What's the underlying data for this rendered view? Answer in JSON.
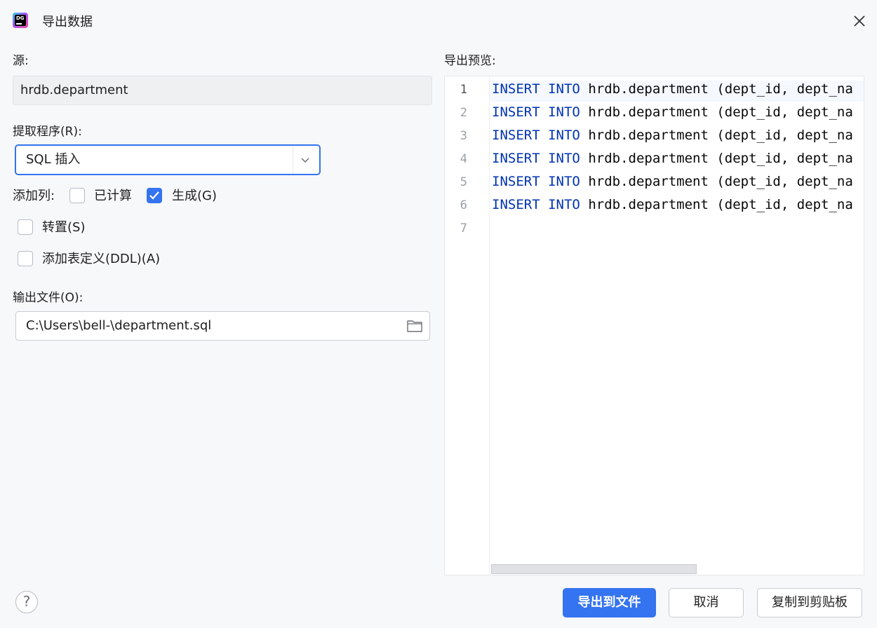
{
  "window": {
    "title": "导出数据"
  },
  "source": {
    "label": "源:",
    "value": "hrdb.department"
  },
  "extractor": {
    "label": "提取程序(R):",
    "selected": "SQL 插入"
  },
  "columns": {
    "label": "添加列:",
    "computed": {
      "label": "已计算",
      "checked": false
    },
    "generated": {
      "label": "生成(G)",
      "checked": true
    }
  },
  "options": {
    "transpose": {
      "label": "转置(S)",
      "checked": false
    },
    "ddl": {
      "label": "添加表定义(DDL)(A)",
      "checked": false
    }
  },
  "output": {
    "label": "输出文件(O):",
    "path": "C:\\Users\\bell-\\department.sql"
  },
  "preview": {
    "label": "导出预览:",
    "lines": [
      {
        "no": "1",
        "kw1": "INSERT",
        "kw2": "INTO",
        "rest": "hrdb.department (dept_id, dept_na"
      },
      {
        "no": "2",
        "kw1": "INSERT",
        "kw2": "INTO",
        "rest": "hrdb.department (dept_id, dept_na"
      },
      {
        "no": "3",
        "kw1": "INSERT",
        "kw2": "INTO",
        "rest": "hrdb.department (dept_id, dept_na"
      },
      {
        "no": "4",
        "kw1": "INSERT",
        "kw2": "INTO",
        "rest": "hrdb.department (dept_id, dept_na"
      },
      {
        "no": "5",
        "kw1": "INSERT",
        "kw2": "INTO",
        "rest": "hrdb.department (dept_id, dept_na"
      },
      {
        "no": "6",
        "kw1": "INSERT",
        "kw2": "INTO",
        "rest": "hrdb.department (dept_id, dept_na"
      },
      {
        "no": "7",
        "kw1": "",
        "kw2": "",
        "rest": ""
      }
    ]
  },
  "footer": {
    "help": "?",
    "export_file": "导出到文件",
    "cancel": "取消",
    "copy_clipboard": "复制到剪贴板"
  },
  "colors": {
    "accent": "#3574f0",
    "keyword": "#0033b3"
  }
}
